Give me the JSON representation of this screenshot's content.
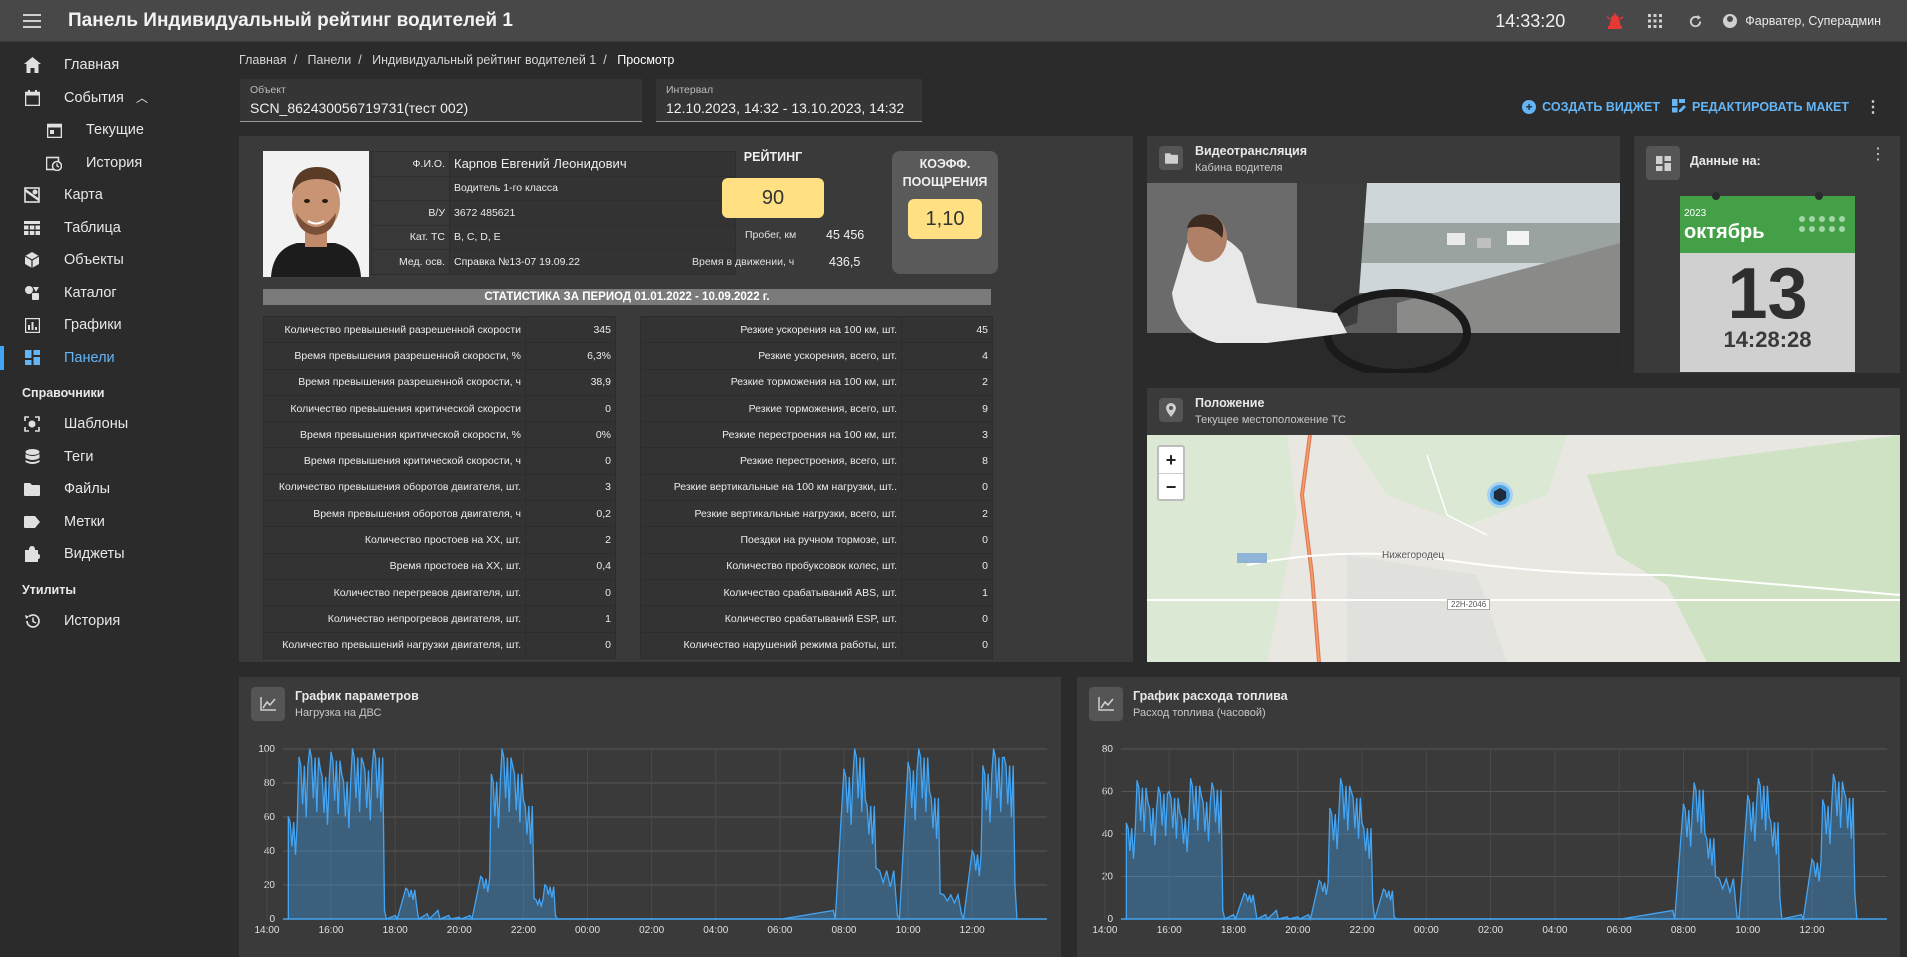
{
  "header": {
    "title": "Панель Индивидуальный рейтинг водителей 1",
    "clock": "14:33:20",
    "user": "Фарватер, Суперадмин"
  },
  "sidebar": {
    "items": [
      {
        "label": "Главная",
        "icon": "home-icon"
      },
      {
        "label": "События",
        "icon": "calendar-icon"
      },
      {
        "label": "Текущие",
        "icon": "calendar-today-icon"
      },
      {
        "label": "История",
        "icon": "calendar-history-icon"
      },
      {
        "label": "Карта",
        "icon": "map-icon"
      },
      {
        "label": "Таблица",
        "icon": "table-icon"
      },
      {
        "label": "Объекты",
        "icon": "cube-icon"
      },
      {
        "label": "Каталог",
        "icon": "catalog-icon"
      },
      {
        "label": "Графики",
        "icon": "chart-icon"
      },
      {
        "label": "Панели",
        "icon": "dashboard-icon"
      }
    ],
    "section_refs": "Справочники",
    "refs": [
      {
        "label": "Шаблоны",
        "icon": "template-icon"
      },
      {
        "label": "Теги",
        "icon": "tags-icon"
      },
      {
        "label": "Файлы",
        "icon": "folder-icon"
      },
      {
        "label": "Метки",
        "icon": "label-icon"
      },
      {
        "label": "Виджеты",
        "icon": "puzzle-icon"
      }
    ],
    "section_utils": "Утилиты",
    "utils": [
      {
        "label": "История",
        "icon": "history-icon"
      }
    ]
  },
  "breadcrumb": [
    "Главная",
    "Панели",
    "Индивидуальный рейтинг водителей 1",
    "Просмотр"
  ],
  "filters": {
    "object_label": "Объект",
    "object_value": "SCN_862430056719731(тест 002)",
    "interval_label": "Интервал",
    "interval_value": "12.10.2023, 14:32 - 13.10.2023, 14:32"
  },
  "actions": {
    "create_widget": "СОЗДАТЬ ВИДЖЕТ",
    "edit_layout": "РЕДАКТИРОВАТЬ МАКЕТ"
  },
  "driver": {
    "rows": [
      {
        "k": "Ф.И.О.",
        "v": "Карпов Евгений Леонидович"
      },
      {
        "k": "",
        "v": "Водитель 1-го класса"
      },
      {
        "k": "В/У",
        "v": "3672 485621"
      },
      {
        "k": "Кат. ТС",
        "v": "B, C, D, E"
      },
      {
        "k": "Мед. осв.",
        "v": "Справка №13-07 19.09.22"
      }
    ],
    "rating_label": "РЕЙТИНГ",
    "rating_value": "90",
    "mileage_label": "Пробег, км",
    "mileage_value": "45 456",
    "moving_label": "Время в движении, ч",
    "moving_value": "436,5",
    "coef_label": "КОЭФФ. ПООЩРЕНИЯ",
    "coef_value": "1,10"
  },
  "stats": {
    "title": "СТАТИСТИКА ЗА ПЕРИОД 01.01.2022 - 10.09.2022 г.",
    "left": [
      {
        "k": "Количество превышений разрешенной скорости",
        "v": "345"
      },
      {
        "k": "Время превышения разрешенной скорости, %",
        "v": "6,3%"
      },
      {
        "k": "Время превышения разрешенной скорости, ч",
        "v": "38,9"
      },
      {
        "k": "Количество превышения критической скорости",
        "v": "0"
      },
      {
        "k": "Время превышения критической скорости, %",
        "v": "0%"
      },
      {
        "k": "Время превышения критической скорости, ч",
        "v": "0"
      },
      {
        "k": "Количество превышения оборотов двигателя, шт.",
        "v": "3"
      },
      {
        "k": "Время превышения оборотов двигателя, ч",
        "v": "0,2"
      },
      {
        "k": "Количество простоев на ХХ, шт.",
        "v": "2"
      },
      {
        "k": "Время простоев на ХХ, шт.",
        "v": "0,4"
      },
      {
        "k": "Количество перегревов двигателя, шт.",
        "v": "0"
      },
      {
        "k": "Количество непрогревов двигателя, шт.",
        "v": "1"
      },
      {
        "k": "Количество превышений нагрузки двигателя, шт.",
        "v": "0"
      }
    ],
    "right": [
      {
        "k": "Резкие ускорения на 100 км, шт.",
        "v": "45"
      },
      {
        "k": "Резкие ускорения, всего, шт.",
        "v": "4"
      },
      {
        "k": "Резкие торможения на 100 км, шт.",
        "v": "2"
      },
      {
        "k": "Резкие торможения, всего, шт.",
        "v": "9"
      },
      {
        "k": "Резкие перестроения на 100 км, шт.",
        "v": "3"
      },
      {
        "k": "Резкие перестроения, всего, шт.",
        "v": "8"
      },
      {
        "k": "Резкие вертикальные на 100 км нагрузки, шт..",
        "v": "0"
      },
      {
        "k": "Резкие вертикальные нагрузки, всего, шт.",
        "v": "2"
      },
      {
        "k": "Поездки на ручном тормозе, шт.",
        "v": "0"
      },
      {
        "k": "Количество пробуксовок колес, шт.",
        "v": "0"
      },
      {
        "k": "Количество срабатываний ABS, шт.",
        "v": "1"
      },
      {
        "k": "Количество срабатываний ESP, шт.",
        "v": "0"
      },
      {
        "k": "Количество нарушений режима работы, шт.",
        "v": "0"
      }
    ]
  },
  "video": {
    "title": "Видеотрансляция",
    "subtitle": "Кабина водителя"
  },
  "date_widget": {
    "title": "Данные на:",
    "year": "2023",
    "month": "октябрь",
    "day": "13",
    "time": "14:28:28"
  },
  "position": {
    "title": "Положение",
    "subtitle": "Текущее местоположение ТС",
    "place": "Нижегородец",
    "road": "22Н-2046",
    "zoom_in": "+",
    "zoom_out": "−"
  },
  "chart_data": [
    {
      "type": "area",
      "title": "График параметров",
      "subtitle": "Нагрузка на ДВС",
      "ylim": [
        0,
        100
      ],
      "yticks": [
        0,
        20,
        40,
        60,
        80,
        100
      ],
      "xticks": [
        "16:00",
        "18:00",
        "20:00",
        "22:00",
        "00:00",
        "02:00",
        "04:00",
        "06:00",
        "08:00",
        "10:00",
        "12:00",
        "14:00"
      ],
      "grid": true,
      "color": "#42a5f5",
      "x": [
        "14:40",
        "15:00",
        "15:20",
        "15:40",
        "16:00",
        "16:20",
        "16:40",
        "17:00",
        "17:20",
        "17:40",
        "18:00",
        "18:20",
        "18:40",
        "19:00",
        "19:20",
        "19:40",
        "20:00",
        "20:20",
        "20:40",
        "21:00",
        "21:20",
        "21:40",
        "22:00",
        "22:20",
        "22:40",
        "23:00",
        "00:00",
        "02:00",
        "04:00",
        "06:00",
        "07:40",
        "08:00",
        "08:20",
        "08:40",
        "09:00",
        "09:40",
        "10:00",
        "10:20",
        "10:40",
        "11:00",
        "11:40",
        "12:00",
        "12:20",
        "12:40",
        "13:00",
        "13:20"
      ],
      "values": [
        60,
        95,
        100,
        88,
        98,
        85,
        100,
        92,
        100,
        5,
        2,
        18,
        8,
        3,
        5,
        2,
        1,
        2,
        25,
        85,
        100,
        90,
        70,
        12,
        20,
        2,
        0,
        0,
        0,
        0,
        5,
        88,
        100,
        70,
        30,
        2,
        92,
        100,
        75,
        15,
        3,
        40,
        90,
        100,
        95,
        20
      ]
    },
    {
      "type": "area",
      "title": "График расхода топлива",
      "subtitle": "Расход топлива (часовой)",
      "ylim": [
        0,
        80
      ],
      "yticks": [
        0,
        20,
        40,
        60,
        80
      ],
      "xticks": [
        "16:00",
        "18:00",
        "20:00",
        "22:00",
        "00:00",
        "02:00",
        "04:00",
        "06:00",
        "08:00",
        "10:00",
        "12:00",
        "14:00"
      ],
      "grid": true,
      "color": "#42a5f5",
      "x": [
        "14:40",
        "15:00",
        "15:20",
        "15:40",
        "16:00",
        "16:20",
        "16:40",
        "17:00",
        "17:20",
        "17:40",
        "18:00",
        "18:20",
        "18:40",
        "19:00",
        "19:20",
        "19:40",
        "20:00",
        "20:20",
        "20:40",
        "21:00",
        "21:20",
        "21:40",
        "22:00",
        "22:20",
        "22:40",
        "23:00",
        "00:00",
        "02:00",
        "04:00",
        "06:00",
        "07:40",
        "08:00",
        "08:20",
        "08:40",
        "09:00",
        "09:40",
        "10:00",
        "10:20",
        "10:40",
        "11:00",
        "11:40",
        "12:00",
        "12:20",
        "12:40",
        "13:00",
        "13:20"
      ],
      "values": [
        45,
        65,
        55,
        62,
        60,
        50,
        66,
        58,
        64,
        4,
        2,
        12,
        6,
        2,
        4,
        1,
        1,
        2,
        18,
        52,
        66,
        60,
        45,
        8,
        14,
        1,
        0,
        0,
        0,
        0,
        4,
        54,
        64,
        40,
        20,
        1,
        58,
        66,
        48,
        10,
        2,
        28,
        56,
        68,
        60,
        12
      ]
    }
  ]
}
